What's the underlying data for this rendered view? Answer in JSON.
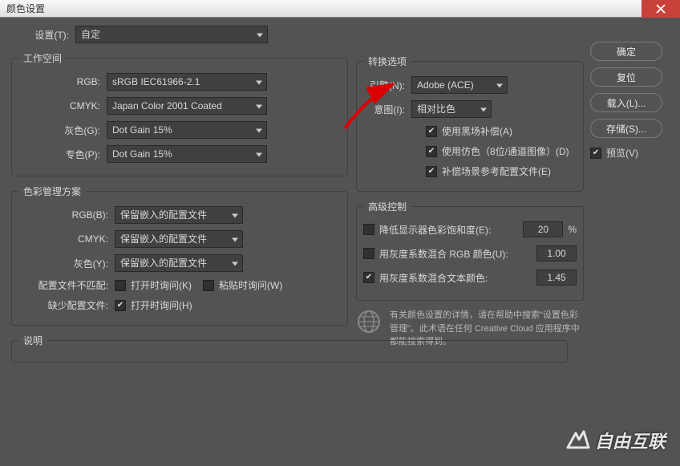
{
  "title": "颜色设置",
  "settings": {
    "label": "设置(T):",
    "value": "自定"
  },
  "workspace": {
    "legend": "工作空间",
    "rgb": {
      "label": "RGB:",
      "value": "sRGB IEC61966-2.1"
    },
    "cmyk": {
      "label": "CMYK:",
      "value": "Japan Color 2001 Coated"
    },
    "gray": {
      "label": "灰色(G):",
      "value": "Dot Gain 15%"
    },
    "spot": {
      "label": "专色(P):",
      "value": "Dot Gain 15%"
    }
  },
  "policy": {
    "legend": "色彩管理方案",
    "rgb": {
      "label": "RGB(B):",
      "value": "保留嵌入的配置文件"
    },
    "cmyk": {
      "label": "CMYK:",
      "value": "保留嵌入的配置文件"
    },
    "gray": {
      "label": "灰色(Y):",
      "value": "保留嵌入的配置文件"
    },
    "mismatch_label": "配置文件不匹配:",
    "mismatch_open": "打开时询问(K)",
    "mismatch_paste": "粘贴时询问(W)",
    "missing_label": "缺少配置文件:",
    "missing_open": "打开时询问(H)"
  },
  "conversion": {
    "legend": "转换选项",
    "engine": {
      "label": "引擎(N):",
      "value": "Adobe (ACE)"
    },
    "intent": {
      "label": "意图(I):",
      "value": "相对比色"
    },
    "bpc": "使用黑场补偿(A)",
    "dither": "使用仿色（8位/通道图像）(D)",
    "compensate": "补偿场景参考配置文件(E)"
  },
  "advanced": {
    "legend": "高级控制",
    "desat": {
      "label": "降低显示器色彩饱和度(E):",
      "value": "20",
      "pct": "%"
    },
    "blend_rgb": {
      "label": "用灰度系数混合 RGB 颜色(U):",
      "value": "1.00"
    },
    "blend_text": {
      "label": "用灰度系数混合文本颜色:",
      "value": "1.45"
    }
  },
  "info_text": "有关颜色设置的详情，请在帮助中搜索\"设置色彩管理\"。此术语在任何 Creative Cloud 应用程序中都能搜索得到。",
  "description_label": "说明",
  "buttons": {
    "ok": "确定",
    "reset": "复位",
    "load": "载入(L)...",
    "save": "存储(S)..."
  },
  "preview_label": "预览(V)",
  "watermark": "自由互联"
}
